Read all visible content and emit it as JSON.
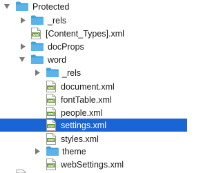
{
  "colors": {
    "selection": "#1a65d6",
    "folder": "#5ab4ea",
    "folder_tab": "#3fa2e0",
    "xml_badge": "#6e9a3b"
  },
  "tree": {
    "root": {
      "label": "Protected",
      "expanded": true,
      "icon": "folder-icon"
    },
    "items": [
      {
        "label": "_rels",
        "kind": "folder",
        "expanded": false
      },
      {
        "label": "[Content_Types].xml",
        "kind": "xml-file"
      },
      {
        "label": "docProps",
        "kind": "folder",
        "expanded": false
      },
      {
        "label": "word",
        "kind": "folder",
        "expanded": true
      },
      {
        "label": "_rels",
        "kind": "folder",
        "expanded": false
      },
      {
        "label": "document.xml",
        "kind": "xml-file"
      },
      {
        "label": "fontTable.xml",
        "kind": "xml-file"
      },
      {
        "label": "people.xml",
        "kind": "xml-file"
      },
      {
        "label": "settings.xml",
        "kind": "xml-file",
        "selected": true
      },
      {
        "label": "styles.xml",
        "kind": "xml-file"
      },
      {
        "label": "theme",
        "kind": "folder",
        "expanded": false
      },
      {
        "label": "webSettings.xml",
        "kind": "xml-file"
      }
    ],
    "xml_badge_text": "xml"
  }
}
